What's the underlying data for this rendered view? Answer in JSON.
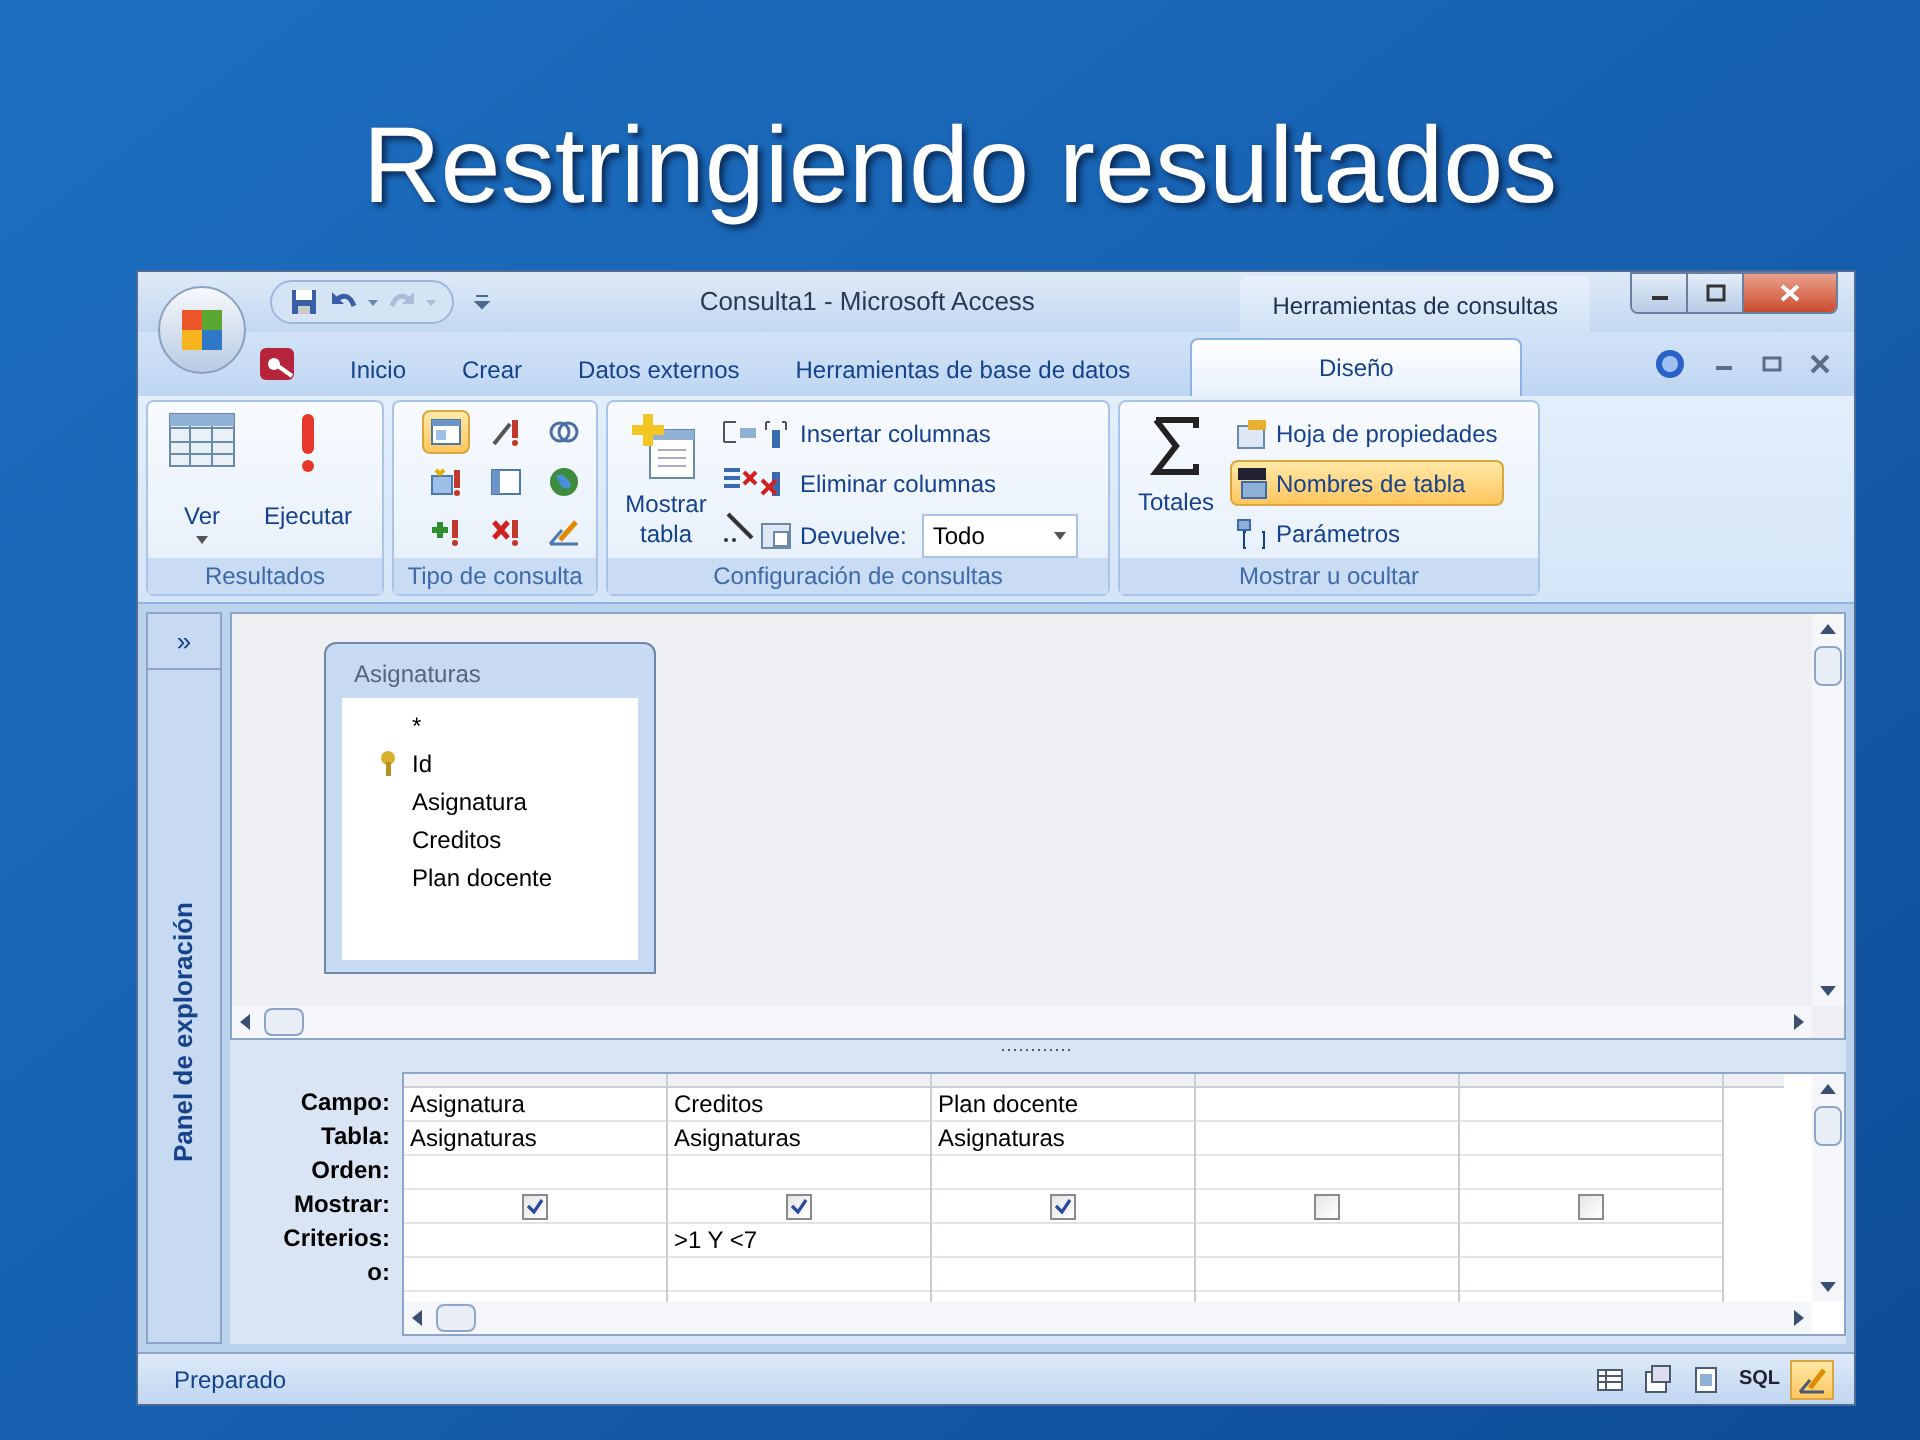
{
  "slide": {
    "title": "Restringiendo resultados"
  },
  "window": {
    "title": "Consulta1 - Microsoft Access",
    "context_title": "Herramientas de consultas"
  },
  "tabs": [
    {
      "label": "Inicio",
      "selected": false
    },
    {
      "label": "Crear",
      "selected": false
    },
    {
      "label": "Datos externos",
      "selected": false
    },
    {
      "label": "Herramientas de base de datos",
      "selected": false
    },
    {
      "label": "Diseño",
      "selected": true
    }
  ],
  "ribbon": {
    "groups": [
      {
        "label": "Resultados",
        "buttons": [
          {
            "label": "Ver",
            "kind": "large"
          },
          {
            "label": "Ejecutar",
            "kind": "large"
          }
        ]
      },
      {
        "label": "Tipo de consulta",
        "buttons": [
          {
            "kind": "icon",
            "selected": true
          },
          {
            "kind": "icon",
            "selected": false
          },
          {
            "kind": "icon",
            "selected": false
          },
          {
            "kind": "icon",
            "selected": false
          },
          {
            "kind": "icon",
            "selected": false
          },
          {
            "kind": "icon",
            "selected": false
          },
          {
            "kind": "icon",
            "selected": false
          },
          {
            "kind": "icon",
            "selected": false
          },
          {
            "kind": "icon",
            "selected": false
          }
        ]
      },
      {
        "label": "Configuración de consultas",
        "buttons": [
          {
            "label": "Mostrar tabla",
            "kind": "large"
          },
          {
            "label": "Insertar columnas",
            "kind": "small"
          },
          {
            "label": "Eliminar columnas",
            "kind": "small"
          },
          {
            "label": "Devuelve:",
            "kind": "dropdown",
            "value": "Todo"
          }
        ]
      },
      {
        "label": "Mostrar u ocultar",
        "buttons": [
          {
            "label": "Totales",
            "kind": "large",
            "selected": false
          },
          {
            "label": "Hoja de propiedades",
            "kind": "small",
            "selected": false
          },
          {
            "label": "Nombres de tabla",
            "kind": "small",
            "selected": true
          },
          {
            "label": "Parámetros",
            "kind": "small",
            "selected": false
          }
        ]
      }
    ]
  },
  "navigation_pane": {
    "toggle": "»",
    "label": "Panel de exploración"
  },
  "table": {
    "title": "Asignaturas",
    "fields": [
      {
        "name": "*",
        "key": false
      },
      {
        "name": "Id",
        "key": true
      },
      {
        "name": "Asignatura",
        "key": false
      },
      {
        "name": "Creditos",
        "key": false
      },
      {
        "name": "Plan docente",
        "key": false
      }
    ]
  },
  "grid": {
    "row_labels": [
      "Campo:",
      "Tabla:",
      "Orden:",
      "Mostrar:",
      "Criterios:",
      "o:"
    ],
    "columns": [
      {
        "campo": "Asignatura",
        "tabla": "Asignaturas",
        "mostrar": true
      },
      {
        "campo": "Creditos",
        "tabla": "Asignaturas",
        "mostrar": true,
        "criterios": ">1 Y <7"
      },
      {
        "campo": "Plan docente",
        "tabla": "Asignaturas",
        "mostrar": true
      },
      {
        "mostrar": false
      },
      {
        "mostrar": false
      }
    ]
  },
  "status_bar": {
    "text": "Preparado",
    "views": [
      {
        "kind": "icon",
        "selected": false
      },
      {
        "kind": "icon",
        "selected": false
      },
      {
        "kind": "icon",
        "selected": false
      },
      {
        "kind": "text",
        "label": "SQL",
        "selected": false
      },
      {
        "kind": "icon",
        "selected": true
      }
    ]
  }
}
